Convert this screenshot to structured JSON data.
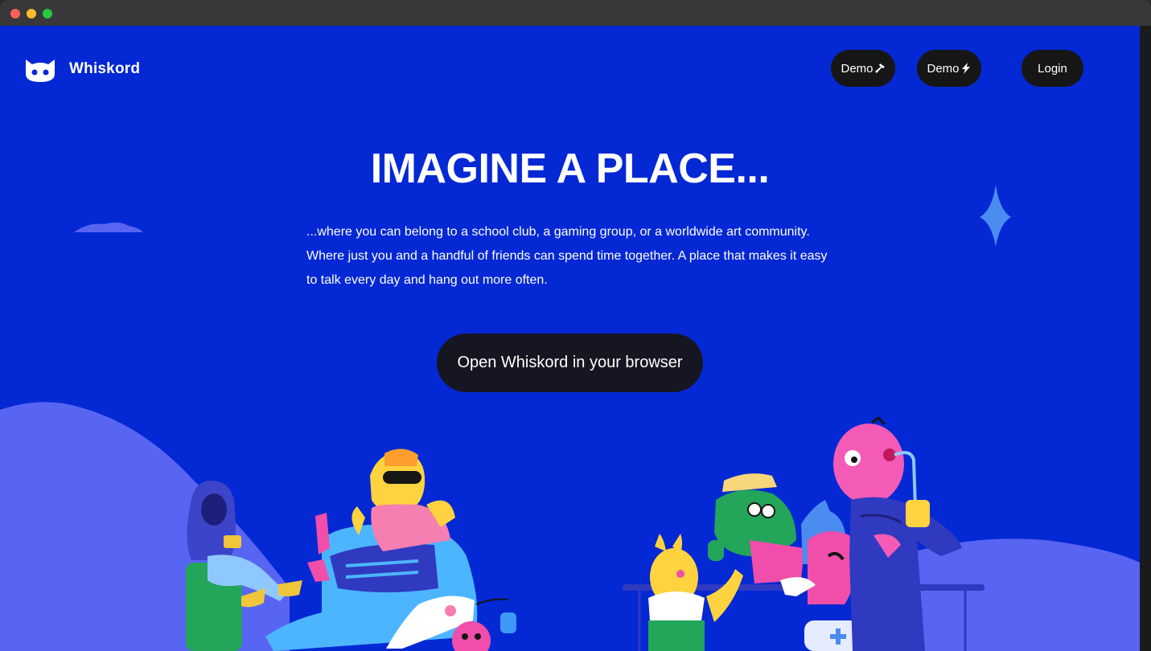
{
  "brand": {
    "name": "Whiskord",
    "logo_icon": "cat-face-icon"
  },
  "nav": {
    "demo1_label": "Demo",
    "demo1_icon": "hammer-icon",
    "demo2_label": "Demo",
    "demo2_icon": "lightning-icon",
    "login_label": "Login"
  },
  "hero": {
    "title": "IMAGINE A PLACE...",
    "body": "...where you can belong to a school club, a gaming group, or a worldwide art community. Where just you and a handful of friends can spend time together. A place that makes it easy to talk every day and hang out more often.",
    "cta_label": "Open Whiskord in your browser"
  },
  "colors": {
    "background": "#0428d4",
    "button": "#161616",
    "hill": "#5865f2",
    "sparkle": "#4a8cf0"
  }
}
